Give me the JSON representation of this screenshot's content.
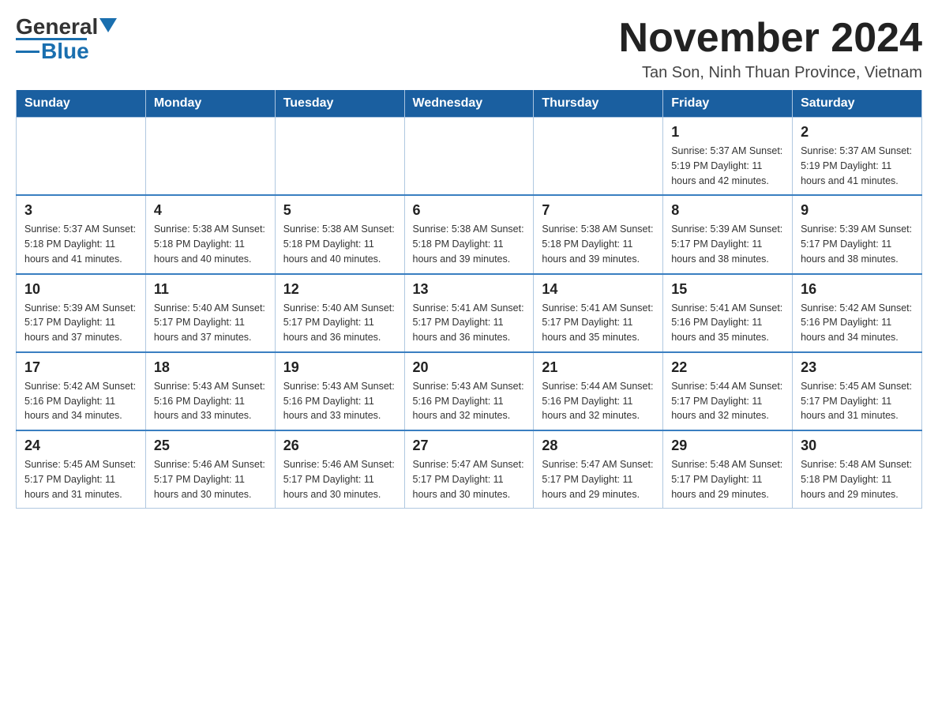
{
  "logo": {
    "general": "General",
    "blue": "Blue"
  },
  "header": {
    "month_year": "November 2024",
    "location": "Tan Son, Ninh Thuan Province, Vietnam"
  },
  "days_of_week": [
    "Sunday",
    "Monday",
    "Tuesday",
    "Wednesday",
    "Thursday",
    "Friday",
    "Saturday"
  ],
  "weeks": [
    [
      {
        "day": "",
        "info": ""
      },
      {
        "day": "",
        "info": ""
      },
      {
        "day": "",
        "info": ""
      },
      {
        "day": "",
        "info": ""
      },
      {
        "day": "",
        "info": ""
      },
      {
        "day": "1",
        "info": "Sunrise: 5:37 AM\nSunset: 5:19 PM\nDaylight: 11 hours\nand 42 minutes."
      },
      {
        "day": "2",
        "info": "Sunrise: 5:37 AM\nSunset: 5:19 PM\nDaylight: 11 hours\nand 41 minutes."
      }
    ],
    [
      {
        "day": "3",
        "info": "Sunrise: 5:37 AM\nSunset: 5:18 PM\nDaylight: 11 hours\nand 41 minutes."
      },
      {
        "day": "4",
        "info": "Sunrise: 5:38 AM\nSunset: 5:18 PM\nDaylight: 11 hours\nand 40 minutes."
      },
      {
        "day": "5",
        "info": "Sunrise: 5:38 AM\nSunset: 5:18 PM\nDaylight: 11 hours\nand 40 minutes."
      },
      {
        "day": "6",
        "info": "Sunrise: 5:38 AM\nSunset: 5:18 PM\nDaylight: 11 hours\nand 39 minutes."
      },
      {
        "day": "7",
        "info": "Sunrise: 5:38 AM\nSunset: 5:18 PM\nDaylight: 11 hours\nand 39 minutes."
      },
      {
        "day": "8",
        "info": "Sunrise: 5:39 AM\nSunset: 5:17 PM\nDaylight: 11 hours\nand 38 minutes."
      },
      {
        "day": "9",
        "info": "Sunrise: 5:39 AM\nSunset: 5:17 PM\nDaylight: 11 hours\nand 38 minutes."
      }
    ],
    [
      {
        "day": "10",
        "info": "Sunrise: 5:39 AM\nSunset: 5:17 PM\nDaylight: 11 hours\nand 37 minutes."
      },
      {
        "day": "11",
        "info": "Sunrise: 5:40 AM\nSunset: 5:17 PM\nDaylight: 11 hours\nand 37 minutes."
      },
      {
        "day": "12",
        "info": "Sunrise: 5:40 AM\nSunset: 5:17 PM\nDaylight: 11 hours\nand 36 minutes."
      },
      {
        "day": "13",
        "info": "Sunrise: 5:41 AM\nSunset: 5:17 PM\nDaylight: 11 hours\nand 36 minutes."
      },
      {
        "day": "14",
        "info": "Sunrise: 5:41 AM\nSunset: 5:17 PM\nDaylight: 11 hours\nand 35 minutes."
      },
      {
        "day": "15",
        "info": "Sunrise: 5:41 AM\nSunset: 5:16 PM\nDaylight: 11 hours\nand 35 minutes."
      },
      {
        "day": "16",
        "info": "Sunrise: 5:42 AM\nSunset: 5:16 PM\nDaylight: 11 hours\nand 34 minutes."
      }
    ],
    [
      {
        "day": "17",
        "info": "Sunrise: 5:42 AM\nSunset: 5:16 PM\nDaylight: 11 hours\nand 34 minutes."
      },
      {
        "day": "18",
        "info": "Sunrise: 5:43 AM\nSunset: 5:16 PM\nDaylight: 11 hours\nand 33 minutes."
      },
      {
        "day": "19",
        "info": "Sunrise: 5:43 AM\nSunset: 5:16 PM\nDaylight: 11 hours\nand 33 minutes."
      },
      {
        "day": "20",
        "info": "Sunrise: 5:43 AM\nSunset: 5:16 PM\nDaylight: 11 hours\nand 32 minutes."
      },
      {
        "day": "21",
        "info": "Sunrise: 5:44 AM\nSunset: 5:16 PM\nDaylight: 11 hours\nand 32 minutes."
      },
      {
        "day": "22",
        "info": "Sunrise: 5:44 AM\nSunset: 5:17 PM\nDaylight: 11 hours\nand 32 minutes."
      },
      {
        "day": "23",
        "info": "Sunrise: 5:45 AM\nSunset: 5:17 PM\nDaylight: 11 hours\nand 31 minutes."
      }
    ],
    [
      {
        "day": "24",
        "info": "Sunrise: 5:45 AM\nSunset: 5:17 PM\nDaylight: 11 hours\nand 31 minutes."
      },
      {
        "day": "25",
        "info": "Sunrise: 5:46 AM\nSunset: 5:17 PM\nDaylight: 11 hours\nand 30 minutes."
      },
      {
        "day": "26",
        "info": "Sunrise: 5:46 AM\nSunset: 5:17 PM\nDaylight: 11 hours\nand 30 minutes."
      },
      {
        "day": "27",
        "info": "Sunrise: 5:47 AM\nSunset: 5:17 PM\nDaylight: 11 hours\nand 30 minutes."
      },
      {
        "day": "28",
        "info": "Sunrise: 5:47 AM\nSunset: 5:17 PM\nDaylight: 11 hours\nand 29 minutes."
      },
      {
        "day": "29",
        "info": "Sunrise: 5:48 AM\nSunset: 5:17 PM\nDaylight: 11 hours\nand 29 minutes."
      },
      {
        "day": "30",
        "info": "Sunrise: 5:48 AM\nSunset: 5:18 PM\nDaylight: 11 hours\nand 29 minutes."
      }
    ]
  ]
}
